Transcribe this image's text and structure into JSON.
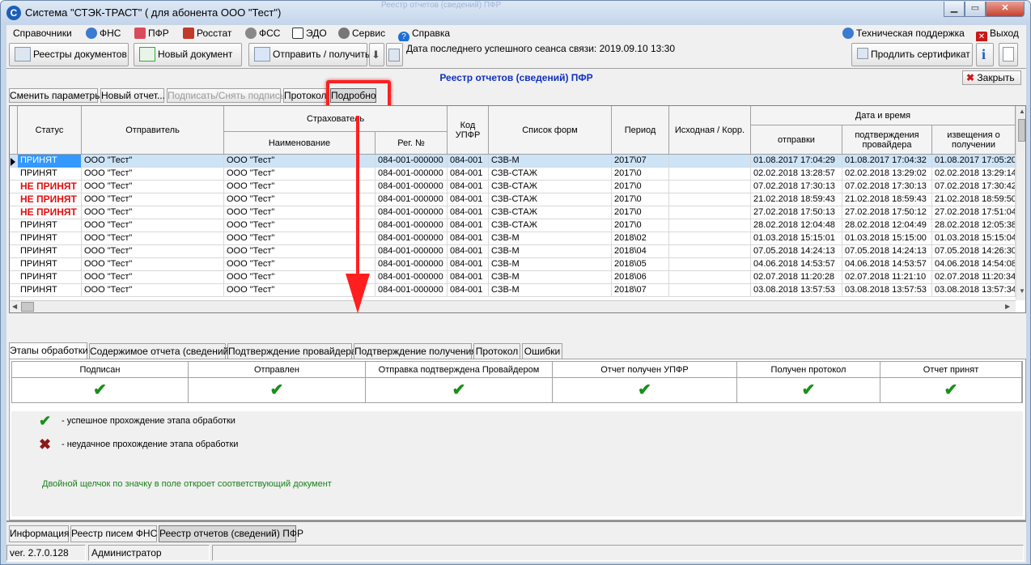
{
  "window": {
    "title": "Система \"СТЭК-ТРАСТ\" ( для абонента ООО \"Тест\")",
    "ghost_title": "Реестр отчетов (сведений) ПФР"
  },
  "menu": {
    "items": [
      "Справочники",
      "ФНС",
      "ПФР",
      "Росстат",
      "ФСС",
      "ЭДО",
      "Сервис",
      "Справка"
    ],
    "support": "Техническая поддержка",
    "exit": "Выход"
  },
  "toolbar": {
    "registries": "Реестры документов",
    "new_doc": "Новый документ",
    "send_receive": "Отправить / получить",
    "last_session": "Дата последнего успешного сеанса связи: 2019.09.10 13:30",
    "extend_cert": "Продлить сертификат"
  },
  "doc": {
    "title": "Реестр отчетов (сведений) ПФР",
    "close": "Закрыть",
    "sub_buttons": [
      "Сменить параметры",
      "Новый отчет...",
      "Подписать/Снять подпись",
      "Протокол",
      "Подробно"
    ]
  },
  "grid": {
    "headers": {
      "status": "Статус",
      "sender": "Отправитель",
      "insurer": "Страхователь",
      "name": "Наименование",
      "reg": "Рег. №",
      "code": "Код УПФР",
      "forms": "Список форм",
      "period": "Период",
      "orig": "Исходная / Корр.",
      "datetime": "Дата и время",
      "sent": "отправки",
      "confirm": "подтверждения провайдера",
      "notice": "извещения о получении"
    },
    "rows": [
      [
        "ПРИНЯТ",
        "ООО \"Тест\"",
        "ООО \"Тест\"",
        "084-001-000000",
        "084-001",
        "СЗВ-М",
        "2017\\07",
        "",
        "01.08.2017 17:04:29",
        "01.08.2017 17:04:32",
        "01.08.2017 17:05:20"
      ],
      [
        "ПРИНЯТ",
        "ООО \"Тест\"",
        "ООО \"Тест\"",
        "084-001-000000",
        "084-001",
        "СЗВ-СТАЖ",
        "2017\\0",
        "",
        "02.02.2018 13:28:57",
        "02.02.2018 13:29:02",
        "02.02.2018 13:29:14"
      ],
      [
        "НЕ ПРИНЯТ",
        "ООО \"Тест\"",
        "ООО \"Тест\"",
        "084-001-000000",
        "084-001",
        "СЗВ-СТАЖ",
        "2017\\0",
        "",
        "07.02.2018 17:30:13",
        "07.02.2018 17:30:13",
        "07.02.2018 17:30:42"
      ],
      [
        "НЕ ПРИНЯТ",
        "ООО \"Тест\"",
        "ООО \"Тест\"",
        "084-001-000000",
        "084-001",
        "СЗВ-СТАЖ",
        "2017\\0",
        "",
        "21.02.2018 18:59:43",
        "21.02.2018 18:59:43",
        "21.02.2018 18:59:50"
      ],
      [
        "НЕ ПРИНЯТ",
        "ООО \"Тест\"",
        "ООО \"Тест\"",
        "084-001-000000",
        "084-001",
        "СЗВ-СТАЖ",
        "2017\\0",
        "",
        "27.02.2018 17:50:13",
        "27.02.2018 17:50:12",
        "27.02.2018 17:51:04"
      ],
      [
        "ПРИНЯТ",
        "ООО \"Тест\"",
        "ООО \"Тест\"",
        "084-001-000000",
        "084-001",
        "СЗВ-СТАЖ",
        "2017\\0",
        "",
        "28.02.2018 12:04:48",
        "28.02.2018 12:04:49",
        "28.02.2018 12:05:38"
      ],
      [
        "ПРИНЯТ",
        "ООО \"Тест\"",
        "ООО \"Тест\"",
        "084-001-000000",
        "084-001",
        "СЗВ-М",
        "2018\\02",
        "",
        "01.03.2018 15:15:01",
        "01.03.2018 15:15:00",
        "01.03.2018 15:15:04"
      ],
      [
        "ПРИНЯТ",
        "ООО \"Тест\"",
        "ООО \"Тест\"",
        "084-001-000000",
        "084-001",
        "СЗВ-М",
        "2018\\04",
        "",
        "07.05.2018 14:24:13",
        "07.05.2018 14:24:13",
        "07.05.2018 14:26:30"
      ],
      [
        "ПРИНЯТ",
        "ООО \"Тест\"",
        "ООО \"Тест\"",
        "084-001-000000",
        "084-001",
        "СЗВ-М",
        "2018\\05",
        "",
        "04.06.2018 14:53:57",
        "04.06.2018 14:53:57",
        "04.06.2018 14:54:08"
      ],
      [
        "ПРИНЯТ",
        "ООО \"Тест\"",
        "ООО \"Тест\"",
        "084-001-000000",
        "084-001",
        "СЗВ-М",
        "2018\\06",
        "",
        "02.07.2018 11:20:28",
        "02.07.2018 11:21:10",
        "02.07.2018 11:20:34"
      ],
      [
        "ПРИНЯТ",
        "ООО \"Тест\"",
        "ООО \"Тест\"",
        "084-001-000000",
        "084-001",
        "СЗВ-М",
        "2018\\07",
        "",
        "03.08.2018 13:57:53",
        "03.08.2018 13:57:53",
        "03.08.2018 13:57:34"
      ]
    ],
    "selected_row": 0
  },
  "bottom_tabs": [
    "Этапы обработки",
    "Содержимое отчета (сведений)",
    "Подтверждение провайдера",
    "Подтверждение получения",
    "Протокол",
    "Ошибки"
  ],
  "stages": {
    "headers": [
      "Подписан",
      "Отправлен",
      "Отправка подтверждена Провайдером",
      "Отчет получен УПФР",
      "Получен протокол",
      "Отчет принят"
    ],
    "check": "✔"
  },
  "legend": {
    "ok_text": "-  успешное прохождение этапа обработки",
    "fail_text": "-  неудачное прохождение этапа обработки",
    "ok_icon": "✔",
    "fail_icon": "✖",
    "hint": "Двойной щелчок по значку в поле откроет соответствующий документ"
  },
  "panel_tabs": [
    "Информация",
    "Реестр писем ФНС",
    "Реестр отчетов (сведений) ПФР"
  ],
  "status": {
    "version": "ver. 2.7.0.128",
    "user": "Администратор"
  },
  "colors": {
    "title_blue": "#1030c0",
    "error_red": "#e01010",
    "ok_green": "#1a8f1a",
    "highlight_red": "#ff1f1f"
  }
}
